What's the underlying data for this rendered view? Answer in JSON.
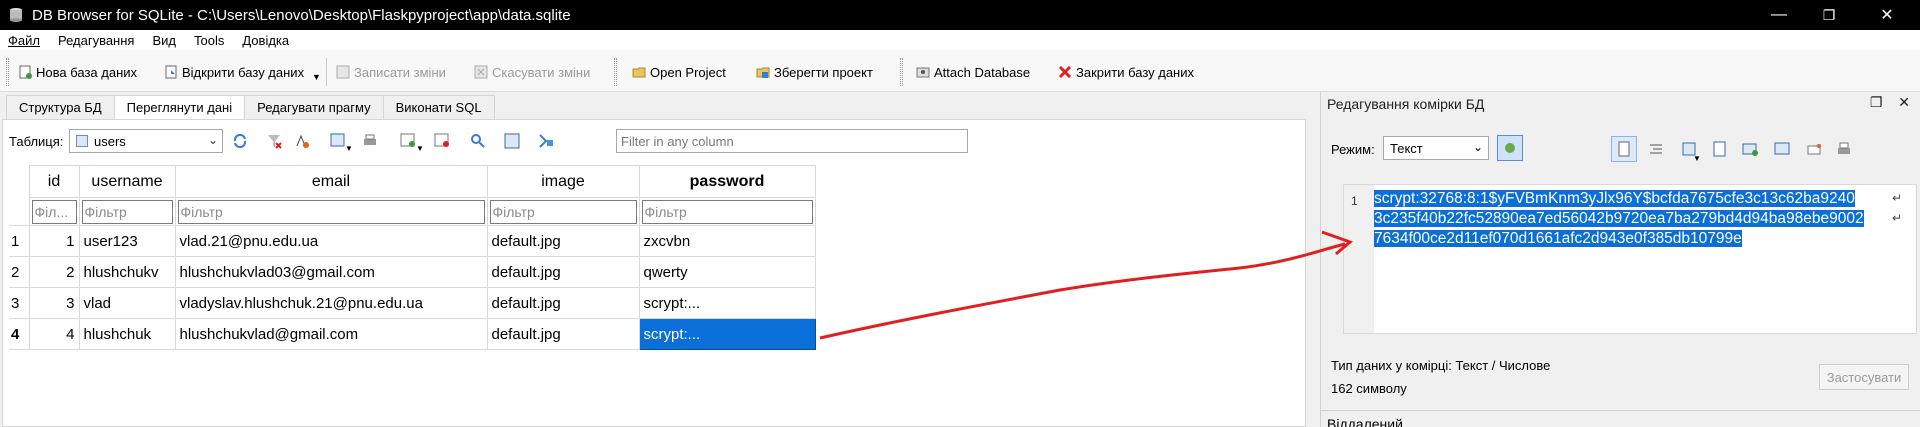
{
  "window": {
    "title": "DB Browser for SQLite - C:\\Users\\Lenovo\\Desktop\\Flaskpyproject\\app\\data.sqlite",
    "minimize": "—",
    "maximize": "❐",
    "close": "✕"
  },
  "menu": [
    "Файл",
    "Редагування",
    "Вид",
    "Tools",
    "Довідка"
  ],
  "toolbar": {
    "new_db": "Нова база даних",
    "open_db": "Відкрити базу даних",
    "write_changes": "Записати зміни",
    "revert_changes": "Скасувати зміни",
    "open_project": "Open Project",
    "save_project": "Зберегти проект",
    "attach_db": "Attach Database",
    "close_db": "Закрити базу даних"
  },
  "tabs": [
    "Структура БД",
    "Переглянути дані",
    "Редагувати прагму",
    "Виконати SQL"
  ],
  "browse": {
    "table_label": "Таблиця:",
    "table_value": "users",
    "filter_placeholder": "Filter in any column"
  },
  "grid": {
    "columns": [
      "id",
      "username",
      "email",
      "image",
      "password"
    ],
    "filters": [
      "Філ...",
      "Фільтр",
      "Фільтр",
      "Фільтр",
      "Фільтр"
    ],
    "rows": [
      {
        "num": "1",
        "id": "1",
        "username": "user123",
        "email": "vlad.21@pnu.edu.ua",
        "image": "default.jpg",
        "password": "zxcvbn"
      },
      {
        "num": "2",
        "id": "2",
        "username": "hlushchukv",
        "email": "hlushchukvlad03@gmail.com",
        "image": "default.jpg",
        "password": "qwerty"
      },
      {
        "num": "3",
        "id": "3",
        "username": "vlad",
        "email": "vladyslav.hlushchuk.21@pnu.edu.ua",
        "image": "default.jpg",
        "password": "scrypt:..."
      },
      {
        "num": "4",
        "id": "4",
        "username": "hlushchuk",
        "email": "hlushchukvlad@gmail.com",
        "image": "default.jpg",
        "password": "scrypt:..."
      }
    ]
  },
  "editcell": {
    "title": "Редагування комірки БД",
    "mode_label": "Режим:",
    "mode_value": "Текст",
    "line_number": "1",
    "lines": [
      "scrypt:32768:8:1$yFVBmKnm3yJlx96Y$bcfda7675cfe3c13c62ba9240",
      "3c235f40b22fc52890ea7ed56042b9720ea7ba279bd4d94ba98ebe9002",
      "7634f00ce2d11ef070d1661afc2d943e0f385db10799e"
    ],
    "type_info": "Тип даних у комірці: Текст / Числове",
    "char_count": "162 символу",
    "apply": "Застосувати",
    "dock_float": "❐",
    "dock_close": "✕"
  },
  "dock2": {
    "title": "Віддалений"
  },
  "colors": {
    "selection": "#0a6fd8",
    "arrow": "#e02020"
  }
}
